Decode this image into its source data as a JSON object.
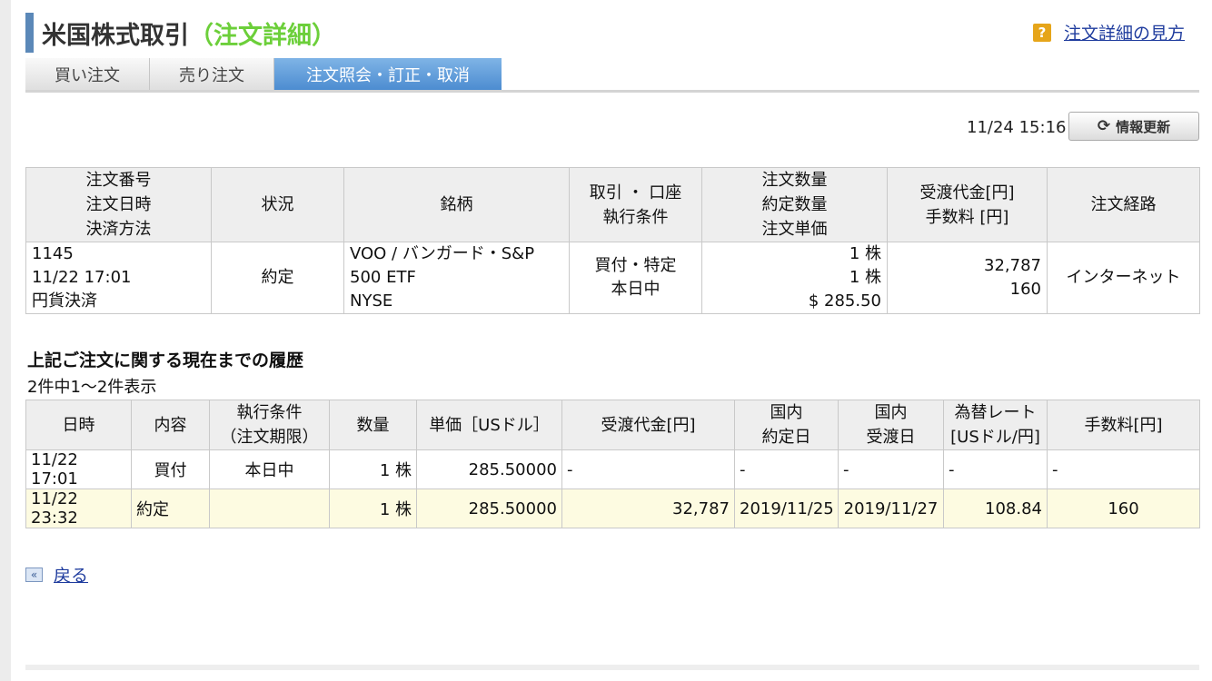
{
  "header": {
    "title": "米国株式取引",
    "subtitle": "（注文詳細）",
    "help_icon": "?",
    "help_link": "注文詳細の見方"
  },
  "tabs": [
    {
      "label": "買い注文",
      "active": false
    },
    {
      "label": "売り注文",
      "active": false
    },
    {
      "label": "注文照会・訂正・取消",
      "active": true
    }
  ],
  "toolbar": {
    "timestamp": "11/24 15:16",
    "refresh_label": "情報更新",
    "refresh_icon": "refresh-icon"
  },
  "order": {
    "headers": {
      "col1": [
        "注文番号",
        "注文日時",
        "決済方法"
      ],
      "col2": "状況",
      "col3": "銘柄",
      "col4": [
        "取引 ・ 口座",
        "執行条件"
      ],
      "col5": [
        "注文数量",
        "約定数量",
        "注文単価"
      ],
      "col6": [
        "受渡代金[円]",
        "手数料 [円]"
      ],
      "col7": "注文経路"
    },
    "row": {
      "order_no": "1145",
      "order_datetime": "11/22 17:01",
      "settlement": "円貨決済",
      "status": "約定",
      "symbol_line1": "VOO / バンガード・S&P",
      "symbol_line2": "500 ETF",
      "symbol_line3": "NYSE",
      "trade_account": "買付・特定",
      "condition": "本日中",
      "order_qty": "1 株",
      "filled_qty": "1 株",
      "price": "$ 285.50",
      "settlement_amount": "32,787",
      "fee": "160",
      "route": "インターネット"
    }
  },
  "history": {
    "section_title": "上記ご注文に関する現在までの履歴",
    "count_text": "2件中1〜2件表示",
    "headers": {
      "datetime": "日時",
      "content": "内容",
      "condition": [
        "執行条件",
        "（注文期限）"
      ],
      "qty": "数量",
      "unit_price": "単価［USドル］",
      "amount": "受渡代金[円]",
      "exec_date": [
        "国内",
        "約定日"
      ],
      "settle_date": [
        "国内",
        "受渡日"
      ],
      "rate": [
        "為替レート",
        "[USドル/円]"
      ],
      "fee": "手数料[円]"
    },
    "rows": [
      {
        "datetime": "11/22 17:01",
        "content": "買付",
        "condition": "本日中",
        "qty": "1 株",
        "unit_price": "285.50000",
        "amount": "-",
        "exec_date": "-",
        "settle_date": "-",
        "rate": "-",
        "fee": "-"
      },
      {
        "datetime": "11/22 23:32",
        "content": "約定",
        "condition": "",
        "qty": "1 株",
        "unit_price": "285.50000",
        "amount": "32,787",
        "exec_date": "2019/11/25",
        "settle_date": "2019/11/27",
        "rate": "108.84",
        "fee": "160"
      }
    ]
  },
  "footer": {
    "back_icon": "«",
    "back_label": "戻る"
  },
  "colors": {
    "accent_blue": "#5b88b8",
    "subtitle_green": "#6ccf3a",
    "link_blue": "#1f3c9e",
    "active_tab": "#4b8bd0",
    "highlight_row": "#fdfbe1"
  }
}
